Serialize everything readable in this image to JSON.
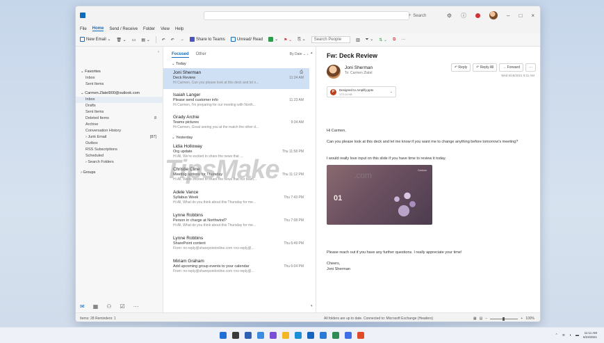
{
  "window": {
    "search_placeholder": "Search",
    "menu": [
      "File",
      "Home",
      "Send / Receive",
      "Folder",
      "View",
      "Help"
    ],
    "active_menu": "Home",
    "ribbon": {
      "new_email": "New Email",
      "share_teams": "Share to Teams",
      "unread_read": "Unread/ Read",
      "search_people": "Search People"
    }
  },
  "folders": {
    "favorites": "Favorites",
    "fav_items": [
      "Inbox",
      "Sent Items"
    ],
    "account": "Carmen.Zlatel900@outlook.com",
    "items": [
      {
        "label": "Inbox",
        "count": ""
      },
      {
        "label": "Drafts",
        "count": ""
      },
      {
        "label": "Sent Items",
        "count": ""
      },
      {
        "label": "Deleted Items",
        "count": "8"
      },
      {
        "label": "Archive",
        "count": ""
      },
      {
        "label": "Conversation History",
        "count": ""
      },
      {
        "label": "Junk Email",
        "count": "[87]"
      },
      {
        "label": "Outbox",
        "count": ""
      },
      {
        "label": "RSS Subscriptions",
        "count": ""
      },
      {
        "label": "Scheduled",
        "count": ""
      },
      {
        "label": "Search Folders",
        "count": ""
      }
    ],
    "groups": "Groups"
  },
  "message_list": {
    "tab_focused": "Focused",
    "tab_other": "Other",
    "sort": "By Date",
    "group_today": "Today",
    "group_yesterday": "Yesterday",
    "messages": [
      {
        "from": "Joni Sherman",
        "subject": "Deck Review",
        "preview": "Hi Carmen, Can you please look at this deck and let n...",
        "time": "11:24 AM"
      },
      {
        "from": "Isaiah Langer",
        "subject": "Please send customer info",
        "preview": "Hi Carmen, I'm preparing for our meeting with North...",
        "time": "11:23 AM"
      },
      {
        "from": "Grady Archie",
        "subject": "Teams pictures",
        "preview": "Hi Carmen, Great seeing you at the match the other d...",
        "time": "9:34 AM"
      },
      {
        "from": "Lidia Holloway",
        "subject": "Org update",
        "preview": "Hi All, We're excited to share the news that ...",
        "time": "Thu 11:58 PM"
      },
      {
        "from": "Christie Cline",
        "subject": "Meeting options for Thursday",
        "preview": "Hi All, We're excited to share the news that our team...",
        "time": "Thu 11:12 PM"
      },
      {
        "from": "Adele Vance",
        "subject": "Syllabus Week",
        "preview": "Hi All, What do you think about this Thursday for me...",
        "time": "Thu 7:43 PM"
      },
      {
        "from": "Lynne Robbins",
        "subject": "Person in charge at Northwind?",
        "preview": "Hi All, What do you think about this Thursday for me...",
        "time": "Thu 7:08 PM"
      },
      {
        "from": "Lynne Robbins",
        "subject": "SharePoint content",
        "preview": "From: no-reply@sharepointonline.com <no-reply@...",
        "time": "Thu 6:49 PM"
      },
      {
        "from": "Miriam Graham",
        "subject": "Add upcoming group events to your calendar",
        "preview": "From: no-reply@sharepointonline.com <no-reply@...",
        "time": "Thu 6:04 PM"
      }
    ]
  },
  "reading": {
    "subject": "Fw: Deck Review",
    "sender": "Joni Sherman",
    "to": "To: Carmen Zlatel",
    "reply": "Reply",
    "reply_all": "Reply All",
    "forward": "Forward",
    "date": "Wed 6/16/2021 9:11 AM",
    "attachment_name": "Designed to Amplify.pptx",
    "attachment_size": "173.14 KB",
    "greeting": "Hi Carmen,",
    "para1": "Can you please look at this deck and let me know if you want me to change anything before tomorrow's meeting?",
    "para2": "I would really love input on this slide if you have time to review it today.",
    "slide_number": "01",
    "slide_header": "Contoso",
    "para3": "Please reach out if you have any further questions. I really appreciate your time!",
    "signoff": "Cheers,",
    "signature": "Joni Sherman"
  },
  "watermark": {
    "main": "TipsMake",
    "suffix": ".com"
  },
  "status": {
    "left": "Items: 28   Reminders: 1",
    "right": "All folders are up to date.   Connected to: Microsoft Exchange (Headers)",
    "zoom": "100%"
  },
  "taskbar": {
    "time": "11:11 AM",
    "date": "6/24/2021",
    "app_colors": [
      "#1f6fd6",
      "#3a3a3a",
      "#2d5fb3",
      "#3c8de0",
      "#7a4fd6",
      "#f3b624",
      "#1a8fd8",
      "#1565c0",
      "#2a79d6",
      "#2e8b57",
      "#3f6ee6",
      "#e04b2a"
    ]
  }
}
